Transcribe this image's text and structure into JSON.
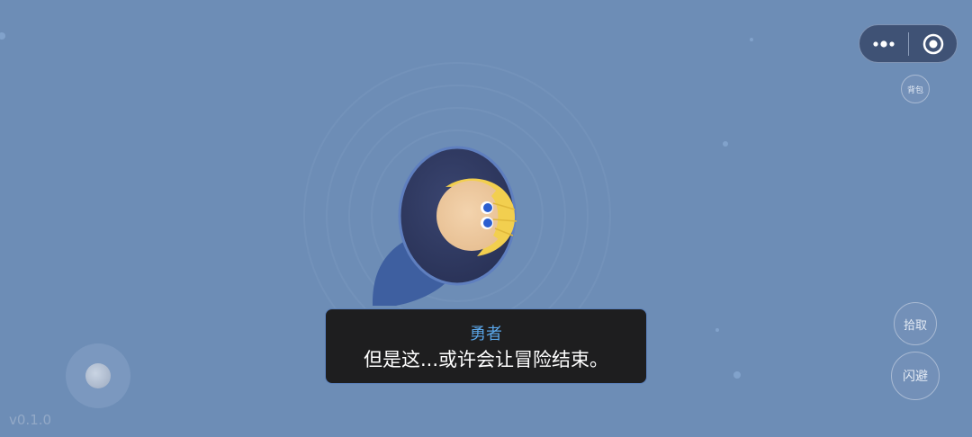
{
  "hud": {
    "bag_label": "背包",
    "pickup_label": "拾取",
    "dodge_label": "闪避",
    "version": "v0.1.0"
  },
  "menu_capsule": {
    "more_icon": "more-dots-icon",
    "close_icon": "target-close-icon"
  },
  "dialog": {
    "speaker": "勇者",
    "text": "但是这...或许会让冒险结束。"
  },
  "colors": {
    "background": "#6d8db6",
    "speaker_name": "#5aa6e9",
    "dialog_bg": "#1e1e1f",
    "hair": "#f2cf4f",
    "eyes": "#2c5fd0"
  }
}
